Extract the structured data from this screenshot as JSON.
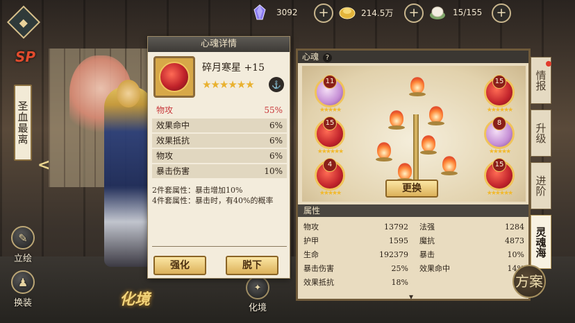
{
  "top_bar": {
    "resources": [
      {
        "icon": "crystal-icon",
        "value": "3092"
      },
      {
        "icon": "gold-ingot-icon",
        "value": "214.5万"
      },
      {
        "icon": "stamina-bun-icon",
        "value": "15/155"
      }
    ]
  },
  "hero": {
    "name": "圣血最离",
    "rarity": "SP",
    "transform_label": "化境"
  },
  "left_menu": {
    "portrait": "立绘",
    "outfit": "换装"
  },
  "detail": {
    "title": "心魂详情",
    "item_name": "碎月寒星 +15",
    "stars": "★★★★★★",
    "main_stat": {
      "name": "物攻",
      "value": "55%"
    },
    "sub_stats": [
      {
        "name": "效果命中",
        "value": "6%"
      },
      {
        "name": "效果抵抗",
        "value": "6%"
      },
      {
        "name": "物攻",
        "value": "6%"
      },
      {
        "name": "暴击伤害",
        "value": "10%"
      }
    ],
    "set_2": "2件套属性：暴击增加10%",
    "set_4": "4件套属性：暴击时，有40%的概率",
    "enhance_label": "强化",
    "remove_label": "脱下"
  },
  "soul_panel": {
    "header": "心魂",
    "help": "?",
    "slots": [
      {
        "level": "11",
        "color": "purple",
        "stars": "★★★★★"
      },
      {
        "level": "15",
        "color": "red",
        "stars": "★★★★★★"
      },
      {
        "level": "4",
        "color": "red",
        "stars": "★★★★★"
      },
      {
        "level": "15",
        "color": "red",
        "stars": "★★★★★★"
      },
      {
        "level": "8",
        "color": "purple",
        "stars": "★★★★★"
      },
      {
        "level": "15",
        "color": "red",
        "stars": "★★★★★★"
      }
    ],
    "replace_label": "更换",
    "attr_header": "属性",
    "attributes": [
      {
        "name": "物攻",
        "value": "13792"
      },
      {
        "name": "法强",
        "value": "1284"
      },
      {
        "name": "护甲",
        "value": "1595"
      },
      {
        "name": "魔抗",
        "value": "4873"
      },
      {
        "name": "生命",
        "value": "192379"
      },
      {
        "name": "暴击",
        "value": "10%"
      },
      {
        "name": "暴击伤害",
        "value": "25%"
      },
      {
        "name": "效果命中",
        "value": "14%"
      },
      {
        "name": "效果抵抗",
        "value": "18%"
      }
    ]
  },
  "side_tabs": {
    "info": "情报",
    "upgrade": "升级",
    "advance": "进阶",
    "soul_sea": "灵魂海"
  },
  "seal": "方案",
  "colors": {
    "accent_gold": "#dcb15a",
    "main_stat_red": "#c8373a",
    "star_gold": "#e9b12f"
  }
}
